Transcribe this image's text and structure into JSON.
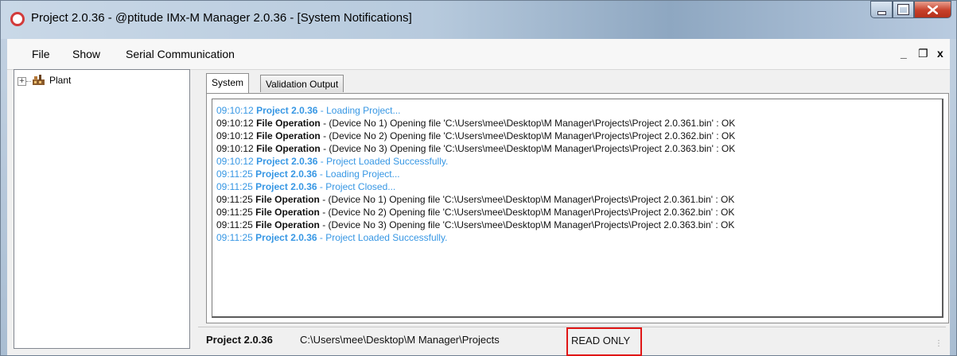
{
  "window": {
    "title": "Project 2.0.36 - @ptitude IMx-M Manager 2.0.36 - [System Notifications]"
  },
  "menu": {
    "file": "File",
    "show": "Show",
    "serial": "Serial Communication"
  },
  "mdi": {
    "minimize": "_",
    "restore": "❐",
    "close": "x"
  },
  "tree": {
    "expander": "+",
    "root_label": "Plant"
  },
  "tabs": [
    {
      "label": "System",
      "active": true
    },
    {
      "label": "Validation Output",
      "active": false
    }
  ],
  "log": [
    {
      "time": "09:10:12",
      "source": "Project 2.0.36",
      "message": " - Loading Project...",
      "kind": "project"
    },
    {
      "time": "09:10:12",
      "source": "File Operation",
      "message": " - (Device No 1) Opening file 'C:\\Users\\mee\\Desktop\\M Manager\\Projects\\Project 2.0.361.bin' : OK",
      "kind": "file"
    },
    {
      "time": "09:10:12",
      "source": "File Operation",
      "message": " - (Device No 2) Opening file 'C:\\Users\\mee\\Desktop\\M Manager\\Projects\\Project 2.0.362.bin' : OK",
      "kind": "file"
    },
    {
      "time": "09:10:12",
      "source": "File Operation",
      "message": " - (Device No 3) Opening file 'C:\\Users\\mee\\Desktop\\M Manager\\Projects\\Project 2.0.363.bin' : OK",
      "kind": "file"
    },
    {
      "time": "09:10:12",
      "source": "Project 2.0.36",
      "message": " - Project Loaded Successfully.",
      "kind": "project"
    },
    {
      "time": "09:11:25",
      "source": "Project 2.0.36",
      "message": " - Loading Project...",
      "kind": "project"
    },
    {
      "time": "09:11:25",
      "source": "Project 2.0.36",
      "message": " - Project Closed...",
      "kind": "project"
    },
    {
      "time": "09:11:25",
      "source": "File Operation",
      "message": " - (Device No 1) Opening file 'C:\\Users\\mee\\Desktop\\M Manager\\Projects\\Project 2.0.361.bin' : OK",
      "kind": "file"
    },
    {
      "time": "09:11:25",
      "source": "File Operation",
      "message": " - (Device No 2) Opening file 'C:\\Users\\mee\\Desktop\\M Manager\\Projects\\Project 2.0.362.bin' : OK",
      "kind": "file"
    },
    {
      "time": "09:11:25",
      "source": "File Operation",
      "message": " - (Device No 3) Opening file 'C:\\Users\\mee\\Desktop\\M Manager\\Projects\\Project 2.0.363.bin' : OK",
      "kind": "file"
    },
    {
      "time": "09:11:25",
      "source": "Project 2.0.36",
      "message": " - Project Loaded Successfully.",
      "kind": "project"
    }
  ],
  "status": {
    "project": "Project 2.0.36",
    "path": "C:\\Users\\mee\\Desktop\\M Manager\\Projects",
    "mode": "READ ONLY"
  },
  "colors": {
    "project_message": "#3797e4",
    "file_message": "#111111",
    "read_only_outline": "#e01616",
    "close_button": "#c7402a"
  },
  "icons": {
    "app": "shield-icon",
    "tree_node": "plant-icon",
    "resize": "size-grip-icon"
  }
}
